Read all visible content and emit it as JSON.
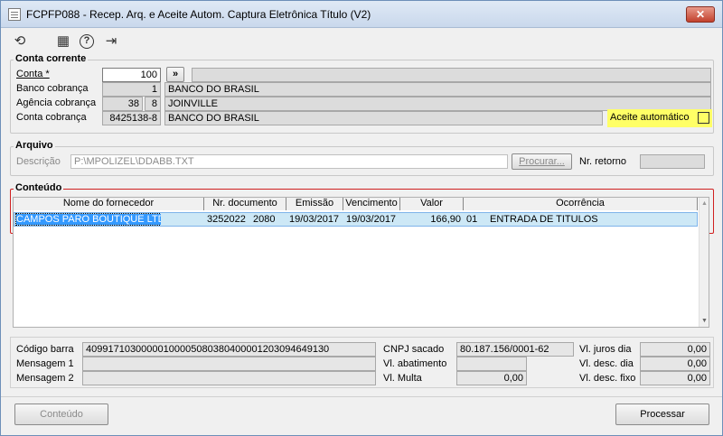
{
  "window": {
    "title": "FCPFP088 - Recep. Arq. e Aceite Autom. Captura Eletrônica Título (V2)",
    "close_label": "✕"
  },
  "toolbar": {
    "icons": [
      "refresh-icon",
      "calendar-icon",
      "help-icon",
      "exit-icon"
    ],
    "glyphs": [
      "⟲",
      "▦",
      "?",
      "⇥"
    ]
  },
  "conta_corrente": {
    "title": "Conta corrente",
    "conta_label": "Conta *",
    "conta_value": "100",
    "nav_button": "»",
    "banco_label": "Banco cobrança",
    "banco_code": "1",
    "banco_name": "BANCO DO BRASIL",
    "agencia_label": "Agência cobrança",
    "agencia_code": "38",
    "agencia_digit": "8",
    "agencia_city": "JOINVILLE",
    "conta_cobranca_label": "Conta cobrança",
    "conta_cobranca_value": "8425138-8",
    "conta_cobranca_bank": "BANCO DO BRASIL",
    "aceite_label": "Aceite automático",
    "highlight_color": "#ffff66"
  },
  "arquivo": {
    "title": "Arquivo",
    "descricao_label": "Descrição",
    "descricao_value": "P:\\MPOLIZEL\\DDABB.TXT",
    "procurar_label": "Procurar...",
    "nr_retorno_label": "Nr. retorno",
    "nr_retorno_value": ""
  },
  "conteudo": {
    "title": "Conteúdo",
    "border_color": "#d02020",
    "columns": [
      "Nome do fornecedor",
      "Nr. documento",
      "Emissão",
      "Vencimento",
      "Valor",
      "Ocorrência"
    ],
    "rows": [
      {
        "fornecedor": "CAMPOS PARO BOUTIQUE LTDA",
        "documento": "3252022",
        "documento_seq": "2080",
        "emissao": "19/03/2017",
        "vencimento": "19/03/2017",
        "valor": "166,90",
        "ocorrencia_code": "01",
        "ocorrencia_desc": "ENTRADA DE TITULOS"
      }
    ],
    "selection_color": "#3399ff",
    "row_color": "#cde8f6"
  },
  "details": {
    "codigo_barra_label": "Código barra",
    "codigo_barra_value": "40991710300000100005080380400001203094649130",
    "mensagem1_label": "Mensagem 1",
    "mensagem1_value": "",
    "mensagem2_label": "Mensagem 2",
    "mensagem2_value": "",
    "cnpj_label": "CNPJ sacado",
    "cnpj_value": "80.187.156/0001-62",
    "abatimento_label": "Vl. abatimento",
    "abatimento_value": "",
    "multa_label": "Vl. Multa",
    "multa_value": "0,00",
    "juros_label": "Vl. juros dia",
    "juros_value": "0,00",
    "desc_dia_label": "Vl. desc. dia",
    "desc_dia_value": "0,00",
    "desc_fixo_label": "Vl. desc. fixo",
    "desc_fixo_value": "0,00"
  },
  "footer": {
    "conteudo_button": "Conteúdo",
    "processar_button": "Processar"
  }
}
